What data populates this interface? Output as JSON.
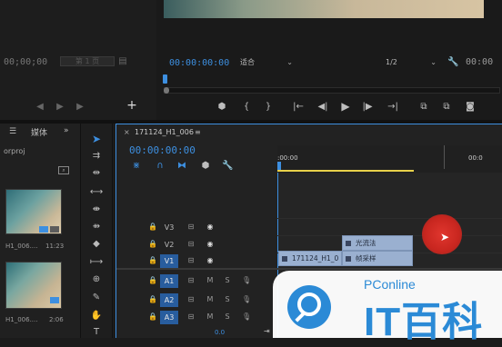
{
  "source_monitor": {
    "timecode": "00;00;00",
    "page_field": "第 1 页"
  },
  "program_monitor": {
    "timecode": "00:00:00:00",
    "fit_label": "适合",
    "resolution": "1/2",
    "end_timecode": "00:00"
  },
  "project_panel": {
    "menu_icon": "☰",
    "tab_label": "媒体",
    "filename": "orproj",
    "thumbnails": [
      {
        "name": "H1_006....",
        "duration": "11:23"
      },
      {
        "name": "H1_006....",
        "duration": "2:06"
      }
    ]
  },
  "timeline": {
    "sequence_tab": "171124_H1_006",
    "timecode": "00:00:00:00",
    "ruler_start": ":00:00",
    "ruler_end": "00:0",
    "video_tracks": [
      {
        "id": "V3",
        "label": "V3",
        "active": false
      },
      {
        "id": "V2",
        "label": "V2",
        "active": false
      },
      {
        "id": "V1",
        "label": "V1",
        "active": true
      }
    ],
    "audio_tracks": [
      {
        "id": "A1",
        "label": "A1",
        "m": "M",
        "s": "S"
      },
      {
        "id": "A2",
        "label": "A2",
        "m": "M",
        "s": "S"
      },
      {
        "id": "A3",
        "label": "A3",
        "m": "M",
        "s": "S"
      }
    ],
    "master_volume": "0.0",
    "clips": {
      "main_clip": "171124_H1_0",
      "effect_1": "光流法",
      "effect_2": "帧采样"
    }
  },
  "watermark": {
    "brand_top": "PConline",
    "brand_bottom": "IT百科"
  },
  "colors": {
    "accent_blue": "#3d8fe0",
    "cursor_red": "#d02a22",
    "clip_blue": "#9ab0d0",
    "track_active": "#285d9e",
    "work_area_yellow": "#e8d14a"
  }
}
